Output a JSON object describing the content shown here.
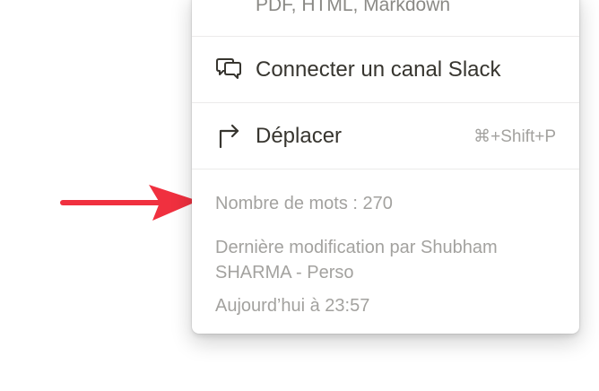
{
  "menu": {
    "export_subtitle": "PDF, HTML, Markdown",
    "items": [
      {
        "label": "Connecter un canal Slack",
        "icon": "slack-chat-icon",
        "shortcut": ""
      },
      {
        "label": "Déplacer",
        "icon": "move-arrow-icon",
        "shortcut": "⌘+Shift+P"
      }
    ],
    "footer": {
      "word_count": "Nombre de mots : 270",
      "last_modified_line1": "Dernière modification par Shubham",
      "last_modified_line2": "SHARMA - Perso",
      "timestamp": "Aujourd’hui à 23:57"
    }
  },
  "annotation": {
    "arrow_color": "#f0303f",
    "arrow_icon": "annotation-arrow-icon"
  }
}
